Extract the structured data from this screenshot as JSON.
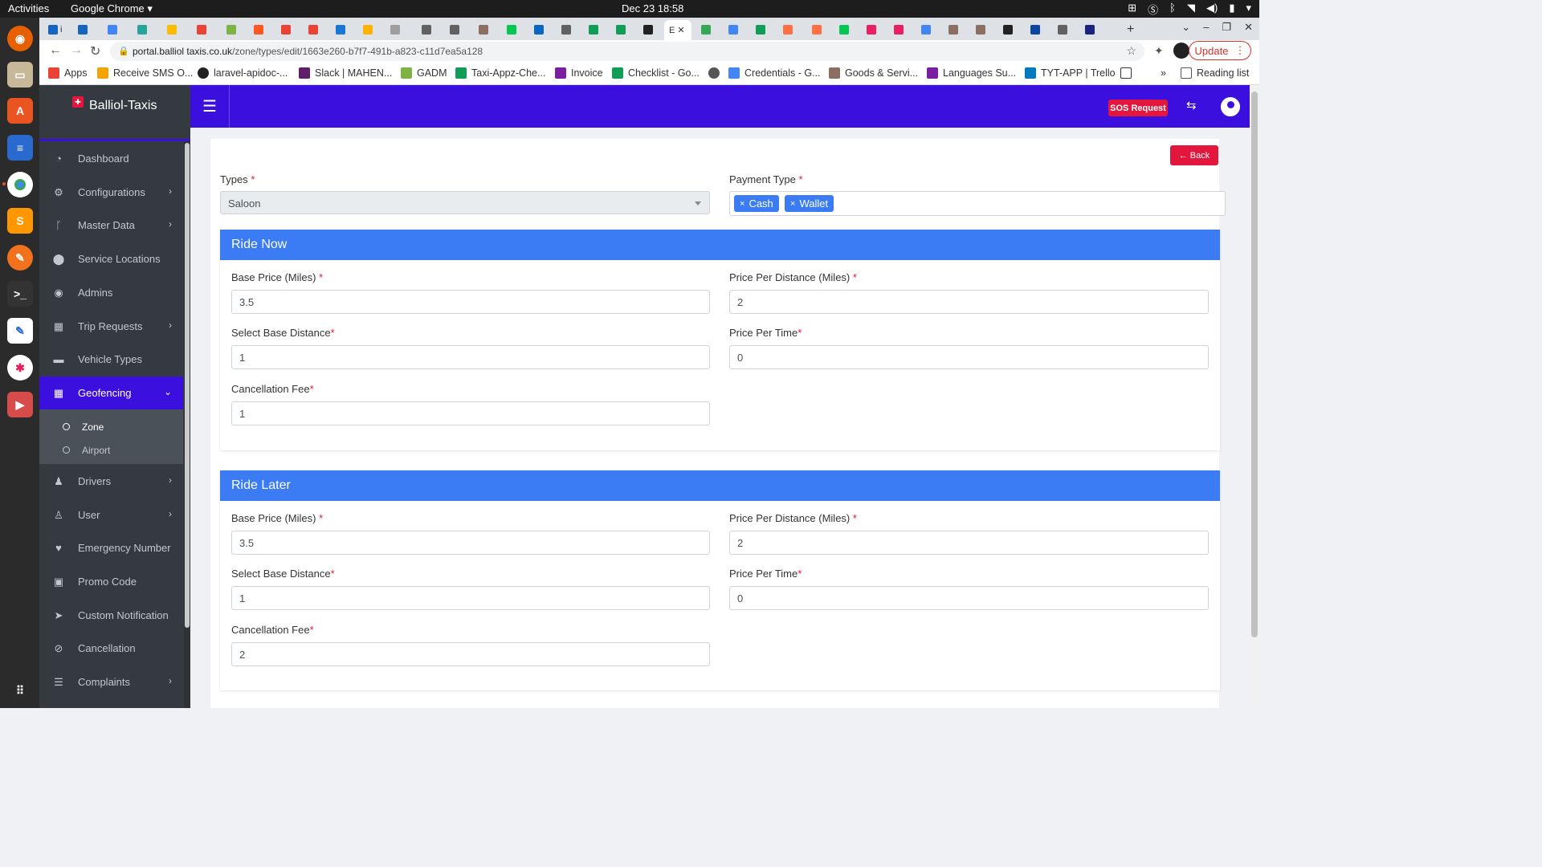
{
  "os": {
    "activities": "Activities",
    "app_name": "Google Chrome",
    "clock": "Dec 23  18:58"
  },
  "browser": {
    "active_tab_label": "E",
    "url_host": "portal.balliolt axis.co.uk",
    "url_display_host": "portal.balliol taxis.co.uk",
    "url_host_exact": "portal.balliol taxis.co.uk",
    "url_domain": "portal.balliol taxis.co.uk",
    "url": "portal.balliol taxis.co.uk/zone/types/edit/1663e260-b7f7-491b-a823-c11d7ea5a128",
    "url_host_text": "portal.balliol taxis.co.uk",
    "omnibox_host": "portal.balliol taxis.co.uk",
    "host": "portal.balliol taxis.co.uk",
    "host_clean": "portal.balliol taxis.co.uk",
    "host_shown": "portal.balliol taxis.co.uk",
    "host_final": "portal.balliol taxis.co.uk",
    "address_host": "portal.balliol taxis.co.uk",
    "address_path": "/zone/types/edit/1663e260-b7f7-491b-a823-c11d7ea5a128",
    "update_label": "Update",
    "bookmarks": [
      {
        "label": "Apps",
        "color": "#ea4335"
      },
      {
        "label": "Receive SMS O...",
        "color": "#f4a300"
      },
      {
        "label": "laravel-apidoc-...",
        "color": "#222222"
      },
      {
        "label": "Slack | MAHEN...",
        "color": "#611f69"
      },
      {
        "label": "GADM",
        "color": "#7cb342"
      },
      {
        "label": "Taxi-Appz-Che...",
        "color": "#0f9d58"
      },
      {
        "label": "Invoice",
        "color": "#7b1fa2"
      },
      {
        "label": "Checklist - Go...",
        "color": "#0f9d58"
      },
      {
        "label": "",
        "color": "#555555"
      },
      {
        "label": "Credentials - G...",
        "color": "#4285f4"
      },
      {
        "label": "Goods & Servi...",
        "color": "#8d6e63"
      },
      {
        "label": "Languages Su...",
        "color": "#7b1fa2"
      },
      {
        "label": "TYT-APP | Trello",
        "color": "#0079bf"
      }
    ],
    "reading_list": "Reading list",
    "more_bookmarks": "»"
  },
  "app": {
    "brand": "Balliol-Taxis",
    "sos_label": "SOS Request",
    "back_label": "← Back",
    "nav": [
      {
        "label": "Dashboard",
        "icon": "dashboard-icon",
        "chevron": false
      },
      {
        "label": "Configurations",
        "icon": "cogs-icon",
        "chevron": true
      },
      {
        "label": "Master Data",
        "icon": "code-branch-icon",
        "chevron": true
      },
      {
        "label": "Service Locations",
        "icon": "map-marker-icon",
        "chevron": false
      },
      {
        "label": "Admins",
        "icon": "user-circle-icon",
        "chevron": false
      },
      {
        "label": "Trip Requests",
        "icon": "map-icon",
        "chevron": true
      },
      {
        "label": "Vehicle Types",
        "icon": "taxi-icon",
        "chevron": false
      },
      {
        "label": "Geofencing",
        "icon": "map-icon",
        "chevron": true
      },
      {
        "label": "Drivers",
        "icon": "users-icon",
        "chevron": true
      },
      {
        "label": "User",
        "icon": "user-icon",
        "chevron": true
      },
      {
        "label": "Emergency Number",
        "icon": "heartbeat-icon",
        "chevron": false
      },
      {
        "label": "Promo Code",
        "icon": "gift-icon",
        "chevron": false
      },
      {
        "label": "Custom Notification",
        "icon": "paper-plane-icon",
        "chevron": false
      },
      {
        "label": "Cancellation",
        "icon": "ban-icon",
        "chevron": false
      },
      {
        "label": "Complaints",
        "icon": "list-icon",
        "chevron": true
      }
    ],
    "geofencing_sub": [
      {
        "label": "Zone"
      },
      {
        "label": "Airport"
      }
    ]
  },
  "form": {
    "types_label": "Types",
    "types_value": "Saloon",
    "payment_label": "Payment Type",
    "payment_chips": [
      "Cash",
      "Wallet"
    ],
    "ride_now": {
      "title": "Ride Now",
      "base_price_label": "Base Price  (Miles)",
      "base_price": "3.5",
      "price_per_distance_label": "Price Per Distance  (Miles)",
      "price_per_distance": "2",
      "base_distance_label": "Select Base Distance",
      "base_distance": "1",
      "price_per_time_label": "Price Per Time",
      "price_per_time": "0",
      "cancellation_label": "Cancellation Fee",
      "cancellation": "1"
    },
    "ride_later": {
      "title": "Ride Later",
      "base_price_label": "Base Price  (Miles)",
      "base_price": "3.5",
      "price_per_distance_label": "Price Per Distance  (Miles)",
      "price_per_distance": "2",
      "base_distance_label": "Select Base Distance",
      "base_distance": "1",
      "price_per_time_label": "Price Per Time",
      "price_per_time": "0",
      "cancellation_label": "Cancellation Fee",
      "cancellation": "2"
    }
  }
}
